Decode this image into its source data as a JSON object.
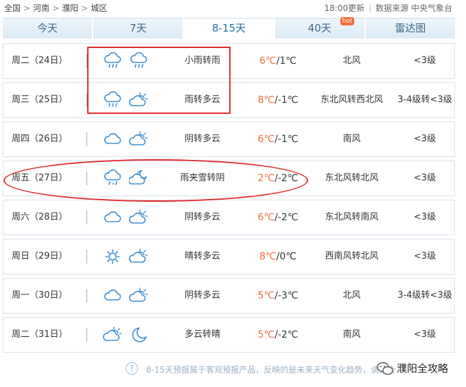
{
  "breadcrumb": [
    "全国",
    "河南",
    "濮阳",
    "城区"
  ],
  "updated": "18:00更新",
  "source": "数据来源 中央气象台",
  "tabs": [
    {
      "label": "今天"
    },
    {
      "label": "7天"
    },
    {
      "label": "8-15天",
      "active": true
    },
    {
      "label": "40天",
      "badge": "hot"
    },
    {
      "label": "雷达图"
    }
  ],
  "colors": {
    "accent": "#1c6fad",
    "high_temp": "#f26c3a",
    "highlight": "#e02b2b"
  },
  "days": [
    {
      "date": "周二（24日）",
      "icons": [
        "cloud-rain-icon",
        "cloud-rain-icon"
      ],
      "weather": "小雨转雨",
      "high": "6℃",
      "low": "/1℃",
      "wind": "北风",
      "level": "<3级"
    },
    {
      "date": "周三（25日）",
      "icons": [
        "cloud-rain-icon",
        "partly-cloudy-icon"
      ],
      "weather": "雨转多云",
      "high": "8℃",
      "low": "/-1℃",
      "wind": "东北风转西北风",
      "level": "3-4级转<3级"
    },
    {
      "date": "周四（26日）",
      "icons": [
        "cloud-icon",
        "partly-cloudy-icon"
      ],
      "weather": "阴转多云",
      "high": "6℃",
      "low": "/-1℃",
      "wind": "南风",
      "level": "<3级"
    },
    {
      "date": "周五（27日）",
      "icons": [
        "cloud-sleet-icon",
        "cloud-moon-icon"
      ],
      "weather": "雨夹雪转阴",
      "high": "2℃",
      "low": "/-2℃",
      "wind": "东北风转北风",
      "level": "<3级"
    },
    {
      "date": "周六（28日）",
      "icons": [
        "cloud-icon",
        "partly-cloudy-icon"
      ],
      "weather": "阴转多云",
      "high": "6℃",
      "low": "/-2℃",
      "wind": "东北风转南风",
      "level": "<3级"
    },
    {
      "date": "周日（29日）",
      "icons": [
        "sun-icon",
        "partly-cloudy-icon"
      ],
      "weather": "晴转多云",
      "high": "8℃",
      "low": "/0℃",
      "wind": "西南风转北风",
      "level": "<3级"
    },
    {
      "date": "周一（30日）",
      "icons": [
        "cloud-icon",
        "partly-cloudy-icon"
      ],
      "weather": "阴转多云",
      "high": "5℃",
      "low": "/-3℃",
      "wind": "北风",
      "level": "3-4级转<3级"
    },
    {
      "date": "周二（31日）",
      "icons": [
        "partly-cloudy-icon",
        "moon-icon"
      ],
      "weather": "多云转晴",
      "high": "5℃",
      "low": "/-2℃",
      "wind": "南风",
      "level": "<3级"
    }
  ],
  "footer_note": "8-15天预报属于客观预报产品，反映的是未来天气变化趋势，请结合",
  "watermark": "濮阳全攻略"
}
